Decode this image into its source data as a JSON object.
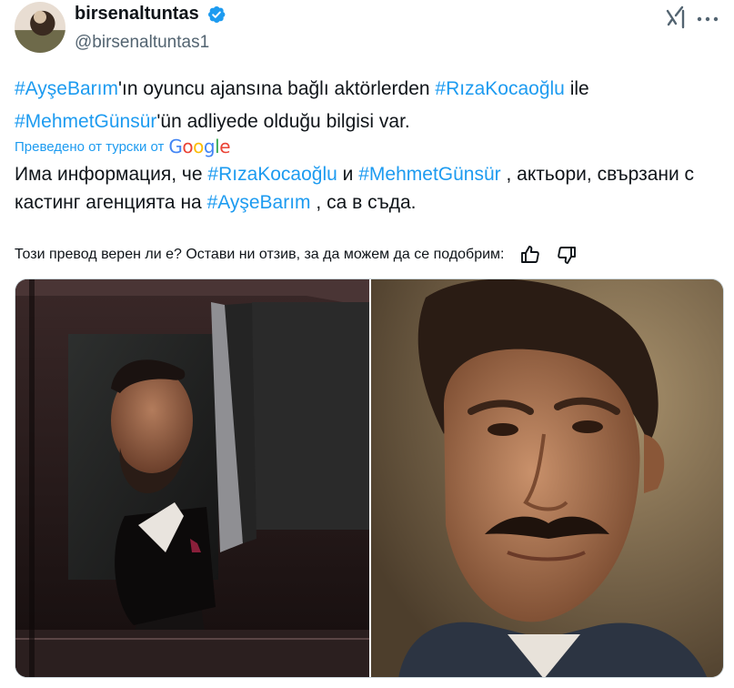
{
  "author": {
    "display_name": "birsenaltuntas",
    "handle": "@birsenaltuntas1",
    "verified_icon": "verified-badge-icon",
    "avatar_icon": "avatar"
  },
  "header_icons": {
    "grok": "xai-grok-icon",
    "more": "more-options-icon"
  },
  "tweet": {
    "tag1": "#AyşeBarım",
    "t1": "'ın oyuncu ajansına bağlı aktörlerden ",
    "tag2": "#RızaKocaoğlu",
    "t2": " ile",
    "tag3": "#MehmetGünsür",
    "t3": "'ün adliyede olduğu bilgisi var."
  },
  "translation": {
    "label": "Преведено от турски от",
    "provider": "Google",
    "t1": "Има информация, че ",
    "tag1": "#RızaKocaoğlu",
    "t2": " и ",
    "tag2": "#MehmetGünsür",
    "t3": " , актьори, свързани с кастинг агенцията на ",
    "tag3": "#AyşeBarım",
    "t4": " , са в съда."
  },
  "feedback": {
    "prompt": "Този превод верен ли е? Остави ни отзив, за да можем да се подобрим:",
    "like_icon": "thumbs-up-icon",
    "dislike_icon": "thumbs-down-icon"
  },
  "media": {
    "left_photo": "man-in-car-photo",
    "right_photo": "man-with-mustache-photo"
  },
  "colors": {
    "accent": "#1d9bf0",
    "text": "#0f1419",
    "secondary": "#536471"
  }
}
